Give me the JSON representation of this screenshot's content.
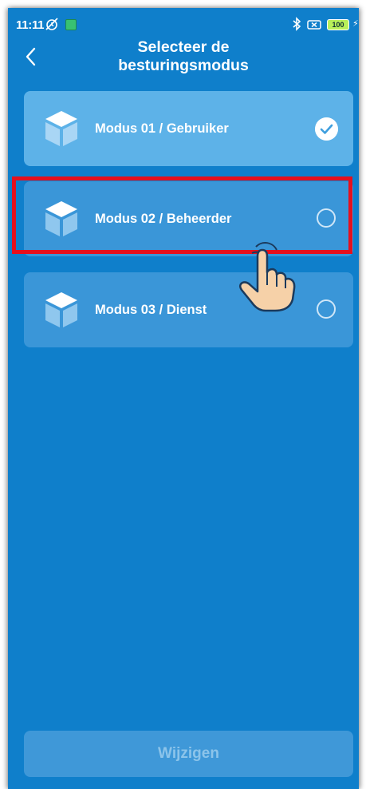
{
  "status_bar": {
    "time": "11:11",
    "battery": "100"
  },
  "header": {
    "title_line1": "Selecteer de",
    "title_line2": "besturingsmodus"
  },
  "modes": [
    {
      "label": "Modus 01 / Gebruiker",
      "selected": true
    },
    {
      "label": "Modus 02 / Beheerder",
      "selected": false
    },
    {
      "label": "Modus 03 / Dienst",
      "selected": false
    }
  ],
  "footer": {
    "change_button_label": "Wijzigen",
    "change_button_enabled": false
  },
  "colors": {
    "background": "#0f7fcb",
    "selected_card": "#5db2e8",
    "card": "#3a96d8",
    "highlight": "#e5101d"
  }
}
